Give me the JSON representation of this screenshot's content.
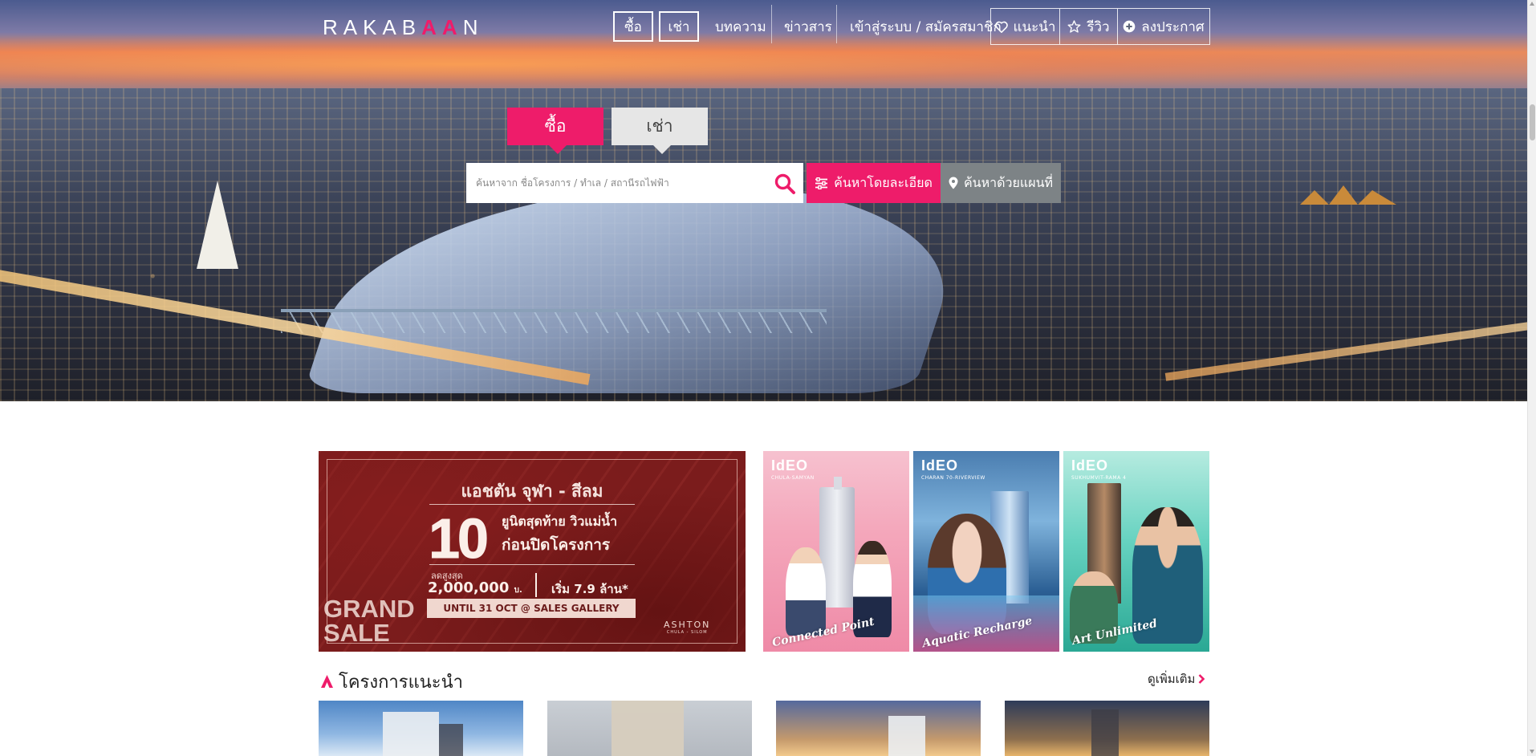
{
  "header": {
    "logo": {
      "part1": "RAKAB",
      "accent": "AA",
      "part2": "N"
    },
    "nav": {
      "buy": "ซื้อ",
      "rent": "เช่า",
      "articles": "บทความ",
      "news": "ข่าวสาร",
      "login": "เข้าสู่ระบบ / สมัครสมาชิก",
      "recommend": "แนะนำ",
      "review": "รีวิว",
      "post": "ลงประกาศ"
    }
  },
  "search": {
    "tab_buy": "ซื้อ",
    "tab_rent": "เช่า",
    "placeholder": "ค้นหาจาก ชื่อโครงการ / ทำเล / สถานีรถไฟฟ้า",
    "advanced_label": "ค้นหาโดยละเอียด",
    "map_label": "ค้นหาด้วยแผนที่"
  },
  "banners": {
    "main": {
      "title": "แอชตัน จุฬา - สีลม",
      "big_number": "10",
      "line1": "ยูนิตสุดท้าย วิวแม่น้ำ",
      "line2": "ก่อนปิดโครงการ",
      "discount_label": "ลดสูงสุด",
      "discount_value": "2,000,000",
      "discount_unit": "บ.",
      "start_price": "เริ่ม 7.9 ล้าน*",
      "until": "UNTIL 31 OCT @ SALES GALLERY",
      "grand": "GRAND SALE",
      "brand": "ASHTON",
      "brand_sub": "CHULA - SILOM"
    },
    "ideo": [
      {
        "logo": "IdEO",
        "location": "CHULA-SAMYAN",
        "tagline": "Connected Point"
      },
      {
        "logo": "IdEO",
        "location": "CHARAN 70-RIVERVIEW",
        "tagline": "Aquatic Recharge"
      },
      {
        "logo": "IdEO",
        "location": "SUKHUMVIT-RAMA 4",
        "tagline": "Art Unlimited"
      }
    ]
  },
  "featured": {
    "title": "โครงการแนะนำ",
    "see_more": "ดูเพิ่มเติม"
  },
  "colors": {
    "accent": "#ee1c6a",
    "map_button": "#7d8386",
    "tab_inactive": "#e6e6e6"
  },
  "icons": {
    "logo_mark": "double-triangle-icon",
    "recommend": "heart-icon",
    "review": "star-icon",
    "post": "plus-circle-icon",
    "search": "search-icon",
    "advanced": "sliders-icon",
    "map": "map-pin-icon",
    "section": "triangle-mark-icon",
    "see_more": "chevron-right-icon"
  }
}
